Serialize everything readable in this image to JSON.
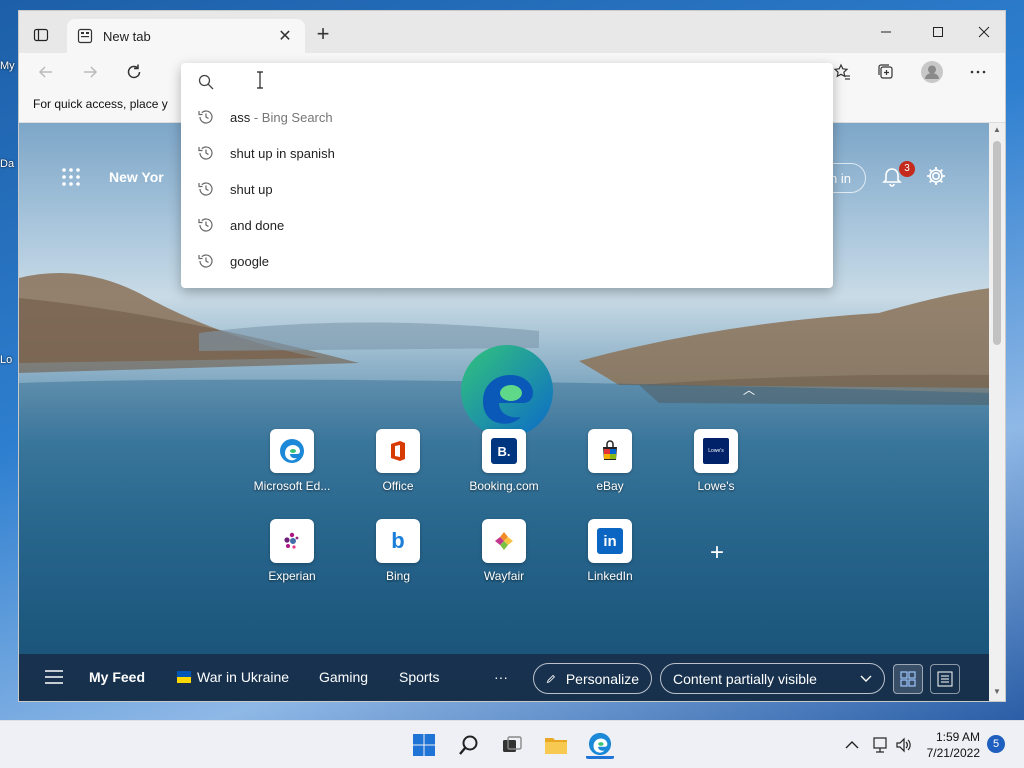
{
  "desktop": {
    "labels": [
      "My",
      "Da",
      "Lo"
    ]
  },
  "browser": {
    "tab_title": "New tab",
    "new_tab_symbol": "+",
    "close_tab_symbol": "✕",
    "favorites_bar_text": "For quick access, place y"
  },
  "newtab": {
    "weather_location": "New Yor",
    "signin_label": "Sign in",
    "notification_count": "3",
    "quick_links": [
      {
        "label": "Microsoft Ed...",
        "icon": "edge-icon"
      },
      {
        "label": "Office",
        "icon": "office-icon"
      },
      {
        "label": "Booking.com",
        "icon": "booking-icon",
        "glyph": "B."
      },
      {
        "label": "eBay",
        "icon": "ebay-icon"
      },
      {
        "label": "Lowe's",
        "icon": "lowes-icon",
        "glyph": "Lowe's"
      },
      {
        "label": "Experian",
        "icon": "experian-icon"
      },
      {
        "label": "Bing",
        "icon": "bing-icon",
        "glyph": "b"
      },
      {
        "label": "Wayfair",
        "icon": "wayfair-icon"
      },
      {
        "label": "LinkedIn",
        "icon": "linkedin-icon",
        "glyph": "in"
      }
    ],
    "add_tile_symbol": "+",
    "feed_bar": {
      "my_feed": "My Feed",
      "war_in_ukraine": "War in Ukraine",
      "gaming": "Gaming",
      "sports": "Sports",
      "more": "···",
      "personalize": "Personalize",
      "content_visibility": "Content partially visible"
    }
  },
  "address_dropdown": {
    "input_value": "",
    "suggestions": [
      {
        "text": "ass",
        "suffix": " - Bing Search"
      },
      {
        "text": "shut up in spanish",
        "suffix": ""
      },
      {
        "text": "shut up",
        "suffix": ""
      },
      {
        "text": "and done",
        "suffix": ""
      },
      {
        "text": "google",
        "suffix": ""
      }
    ]
  },
  "taskbar": {
    "time": "1:59 AM",
    "date": "7/21/2022",
    "notification_count": "5"
  },
  "colors": {
    "accent": "#0f6cbd",
    "notification_red": "#c42b1c",
    "ebay_red": "#e53238",
    "linkedin_blue": "#0a66c2",
    "booking_blue": "#003580",
    "lowes_navy": "#012169"
  }
}
